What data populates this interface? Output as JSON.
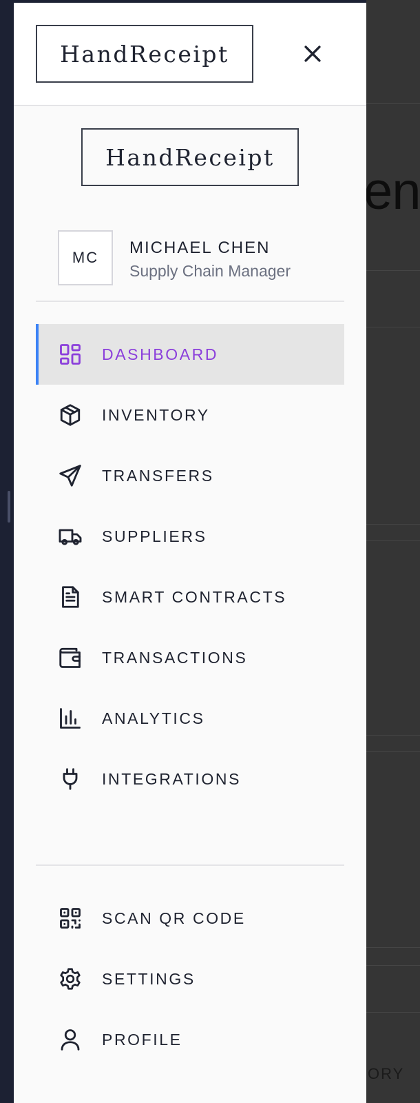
{
  "app": {
    "logo_text": "HandReceipt",
    "body_logo_text": "HandReceipt"
  },
  "background": {
    "heading_fragment": "en",
    "footer_fragment": "ORY"
  },
  "user": {
    "initials": "MC",
    "name": "MICHAEL CHEN",
    "role": "Supply Chain Manager"
  },
  "nav": {
    "items": [
      {
        "label": "DASHBOARD",
        "icon": "dashboard-grid-icon",
        "active": true
      },
      {
        "label": "INVENTORY",
        "icon": "package-box-icon",
        "active": false
      },
      {
        "label": "TRANSFERS",
        "icon": "send-plane-icon",
        "active": false
      },
      {
        "label": "SUPPLIERS",
        "icon": "truck-icon",
        "active": false
      },
      {
        "label": "SMART CONTRACTS",
        "icon": "document-icon",
        "active": false
      },
      {
        "label": "TRANSACTIONS",
        "icon": "wallet-icon",
        "active": false
      },
      {
        "label": "ANALYTICS",
        "icon": "bar-chart-icon",
        "active": false
      },
      {
        "label": "INTEGRATIONS",
        "icon": "plug-icon",
        "active": false
      }
    ]
  },
  "bottom_nav": {
    "items": [
      {
        "label": "SCAN QR CODE",
        "icon": "qr-code-icon"
      },
      {
        "label": "SETTINGS",
        "icon": "gear-icon"
      },
      {
        "label": "PROFILE",
        "icon": "user-icon"
      }
    ]
  },
  "colors": {
    "active_accent": "#3b82f6",
    "active_text": "#8b3fdb",
    "active_bg": "#e5e5e5",
    "text": "#1f2330",
    "muted": "#6b7080"
  }
}
